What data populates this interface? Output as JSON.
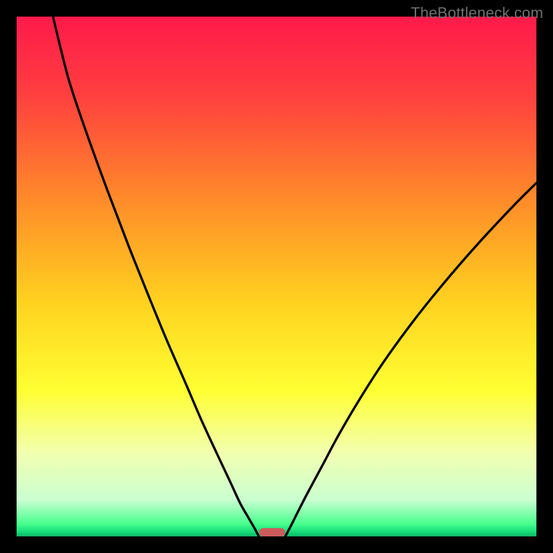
{
  "watermark": "TheBottleneck.com",
  "chart_data": {
    "type": "line",
    "title": "",
    "xlabel": "",
    "ylabel": "",
    "xlim": [
      0,
      100
    ],
    "ylim": [
      0,
      100
    ],
    "background_gradient": {
      "stops": [
        {
          "offset": 0.0,
          "color": "#ff1a4b"
        },
        {
          "offset": 0.15,
          "color": "#ff3f3f"
        },
        {
          "offset": 0.35,
          "color": "#ff8a2a"
        },
        {
          "offset": 0.55,
          "color": "#ffd21f"
        },
        {
          "offset": 0.72,
          "color": "#ffff33"
        },
        {
          "offset": 0.84,
          "color": "#f2ffb0"
        },
        {
          "offset": 0.93,
          "color": "#c9ffd1"
        },
        {
          "offset": 0.975,
          "color": "#4bff8f"
        },
        {
          "offset": 0.99,
          "color": "#18e07a"
        },
        {
          "offset": 1.0,
          "color": "#0fb768"
        }
      ]
    },
    "series": [
      {
        "name": "left-branch",
        "type": "line",
        "x": [
          7.0,
          10.0,
          13.5,
          17.5,
          21.5,
          25.5,
          29.0,
          32.5,
          35.5,
          38.5,
          41.0,
          43.0,
          44.6,
          45.7,
          46.6
        ],
        "values": [
          100.0,
          88.0,
          77.5,
          66.5,
          56.0,
          46.0,
          37.5,
          29.5,
          22.5,
          16.0,
          10.7,
          6.4,
          3.6,
          1.7,
          0.0
        ]
      },
      {
        "name": "right-branch",
        "type": "line",
        "x": [
          51.7,
          52.7,
          54.0,
          56.0,
          58.8,
          62.0,
          66.0,
          70.5,
          76.0,
          82.0,
          88.5,
          95.5,
          100.0
        ],
        "values": [
          0.0,
          1.9,
          4.5,
          8.4,
          13.6,
          19.6,
          26.4,
          33.4,
          41.0,
          48.5,
          56.0,
          63.5,
          68.0
        ]
      }
    ],
    "marker": {
      "name": "bottleneck-marker",
      "x_center": 49.15,
      "width": 5.0,
      "height": 1.6,
      "color": "#cd5c5c"
    }
  }
}
